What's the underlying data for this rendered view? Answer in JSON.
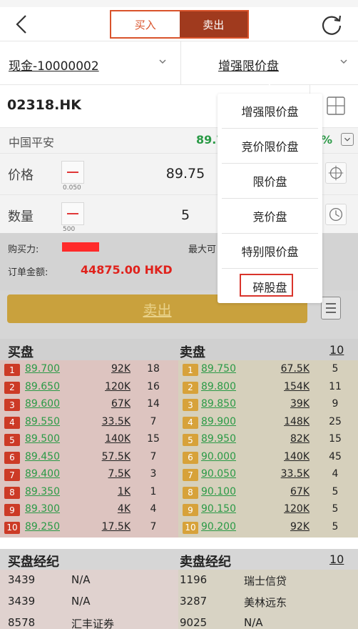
{
  "header": {
    "buy_label": "买入",
    "sell_label": "卖出",
    "back_icon": "chevron-left-icon",
    "refresh_icon": "refresh-icon"
  },
  "account": {
    "label": "现金-10000002",
    "order_type": "增强限价盘"
  },
  "stock": {
    "code": "02318.HK",
    "name": "中国平安",
    "last_price_fragment": "89.7",
    "pct_fragment": "%"
  },
  "form": {
    "price_label": "价格",
    "price_step": "0.050",
    "price_value": "89.75",
    "qty_label": "数量",
    "qty_step": "500",
    "qty_value": "5",
    "buying_power_label": "购买力:",
    "max_label": "最大可",
    "amount_label": "订单金额:",
    "amount_value": "44875.00 HKD",
    "submit_label": "卖出"
  },
  "order_book": {
    "bid_title": "买盘",
    "ask_title": "卖盘",
    "level_link": "10",
    "bids": [
      {
        "level": "1",
        "price": "89.700",
        "volume": "92K",
        "count": "18"
      },
      {
        "level": "2",
        "price": "89.650",
        "volume": "120K",
        "count": "16"
      },
      {
        "level": "3",
        "price": "89.600",
        "volume": "67K",
        "count": "14"
      },
      {
        "level": "4",
        "price": "89.550",
        "volume": "33.5K",
        "count": "7"
      },
      {
        "level": "5",
        "price": "89.500",
        "volume": "140K",
        "count": "15"
      },
      {
        "level": "6",
        "price": "89.450",
        "volume": "57.5K",
        "count": "7"
      },
      {
        "level": "7",
        "price": "89.400",
        "volume": "7.5K",
        "count": "3"
      },
      {
        "level": "8",
        "price": "89.350",
        "volume": "1K",
        "count": "1"
      },
      {
        "level": "9",
        "price": "89.300",
        "volume": "4K",
        "count": "4"
      },
      {
        "level": "10",
        "price": "89.250",
        "volume": "17.5K",
        "count": "7"
      }
    ],
    "asks": [
      {
        "level": "1",
        "price": "89.750",
        "volume": "67.5K",
        "count": "5"
      },
      {
        "level": "2",
        "price": "89.800",
        "volume": "154K",
        "count": "11"
      },
      {
        "level": "3",
        "price": "89.850",
        "volume": "39K",
        "count": "9"
      },
      {
        "level": "4",
        "price": "89.900",
        "volume": "148K",
        "count": "25"
      },
      {
        "level": "5",
        "price": "89.950",
        "volume": "82K",
        "count": "15"
      },
      {
        "level": "6",
        "price": "90.000",
        "volume": "140K",
        "count": "45"
      },
      {
        "level": "7",
        "price": "90.050",
        "volume": "33.5K",
        "count": "4"
      },
      {
        "level": "8",
        "price": "90.100",
        "volume": "67K",
        "count": "5"
      },
      {
        "level": "9",
        "price": "90.150",
        "volume": "120K",
        "count": "5"
      },
      {
        "level": "10",
        "price": "90.200",
        "volume": "92K",
        "count": "5"
      }
    ]
  },
  "brokers": {
    "bid_title": "买盘经纪",
    "ask_title": "卖盘经纪",
    "level_link": "10",
    "bid_rows": [
      {
        "id": "3439",
        "name": "N/A"
      },
      {
        "id": "3439",
        "name": "N/A"
      },
      {
        "id": "8578",
        "name": "汇丰证券"
      }
    ],
    "ask_rows": [
      {
        "id": "1196",
        "name": "瑞士信贷"
      },
      {
        "id": "3287",
        "name": "美林远东"
      },
      {
        "id": "9025",
        "name": "N/A"
      }
    ]
  },
  "dropdown": {
    "options": [
      "增强限价盘",
      "竞价限价盘",
      "限价盘",
      "竞价盘",
      "特别限价盘",
      "碎股盘"
    ],
    "highlighted": "碎股盘"
  },
  "colors": {
    "accent": "#d9532b",
    "bid_red": "#cc3a26",
    "ask_gold": "#d7a23a",
    "up_green": "#2a9a46",
    "highlight_red": "#d9342b"
  }
}
